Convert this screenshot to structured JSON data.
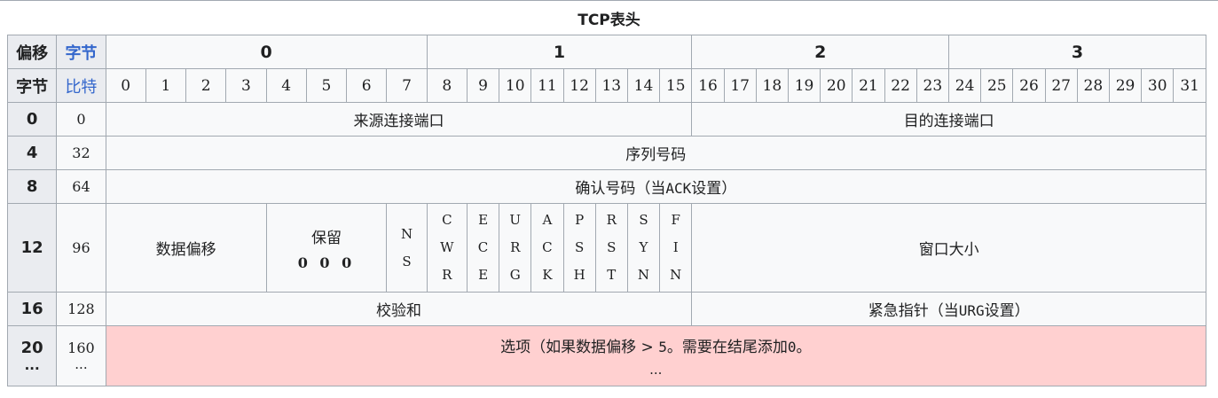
{
  "caption": "TCP表头",
  "header": {
    "offset_label": "偏移",
    "byte_label": "字节",
    "byte_label2": "字节",
    "bit_label": "比特",
    "bytes": [
      "0",
      "1",
      "2",
      "3"
    ],
    "bits": [
      "0",
      "1",
      "2",
      "3",
      "4",
      "5",
      "6",
      "7",
      "8",
      "9",
      "10",
      "11",
      "12",
      "13",
      "14",
      "15",
      "16",
      "17",
      "18",
      "19",
      "20",
      "21",
      "22",
      "23",
      "24",
      "25",
      "26",
      "27",
      "28",
      "29",
      "30",
      "31"
    ]
  },
  "rows": {
    "r0": {
      "off": "0",
      "bit": "0",
      "src_port": "来源连接端口",
      "dst_port": "目的连接端口"
    },
    "r4": {
      "off": "4",
      "bit": "32",
      "seq": "序列号码"
    },
    "r8": {
      "off": "8",
      "bit": "64",
      "ack_main": "确认号码（当",
      "ack_mono": "ACK",
      "ack_tail": "设置）"
    },
    "r12": {
      "off": "12",
      "bit": "96",
      "data_offset": "数据偏移",
      "reserved": "保留",
      "reserved_bits": "0 0 0",
      "flags": [
        [
          "N",
          "S"
        ],
        [
          "C",
          "W",
          "R"
        ],
        [
          "E",
          "C",
          "E"
        ],
        [
          "U",
          "R",
          "G"
        ],
        [
          "A",
          "C",
          "K"
        ],
        [
          "P",
          "S",
          "H"
        ],
        [
          "R",
          "S",
          "T"
        ],
        [
          "S",
          "Y",
          "N"
        ],
        [
          "F",
          "I",
          "N"
        ]
      ],
      "window": "窗口大小"
    },
    "r16": {
      "off": "16",
      "bit": "128",
      "checksum": "校验和",
      "urg_main": "紧急指针（当",
      "urg_mono": "URG",
      "urg_tail": "设置）"
    },
    "r20": {
      "off": "20",
      "off2": "...",
      "bit": "160",
      "bit2": "...",
      "options_a": "选项（如果数据偏移 > ",
      "options_b": "5",
      "options_c": "。需要在结尾添加",
      "options_d": "0",
      "options_e": "。",
      "options_more": "..."
    }
  }
}
